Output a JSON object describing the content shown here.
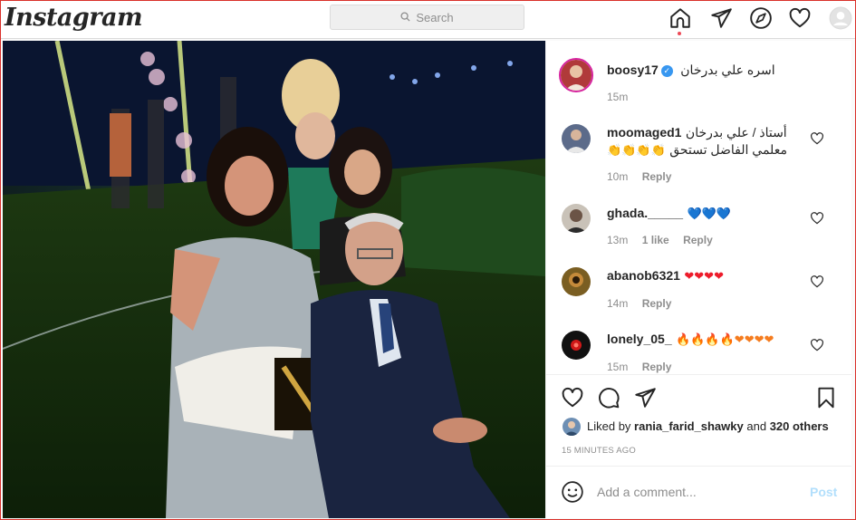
{
  "nav": {
    "logo": "Instagram",
    "search_placeholder": "Search",
    "icons": [
      "home-icon",
      "direct-icon",
      "explore-icon",
      "activity-heart-icon",
      "profile-avatar-icon"
    ]
  },
  "post": {
    "author": "boosy17",
    "caption": "اسره علي بدرخان",
    "time": "15m",
    "comments": [
      {
        "user": "moomaged1",
        "text_line1": "أستاذ / علي بدرخان",
        "text_line2": "معلمي الفاضل تستحق",
        "emoji": "👏👏👏👏",
        "time": "10m",
        "likes": "",
        "reply": "Reply"
      },
      {
        "user": "ghada._____",
        "text_line1": "💙💙💙",
        "text_line2": "",
        "emoji": "",
        "time": "13m",
        "likes": "1 like",
        "reply": "Reply"
      },
      {
        "user": "abanob6321",
        "text_line1": "❤❤❤❤",
        "text_line2": "",
        "emoji": "",
        "time": "14m",
        "likes": "",
        "reply": "Reply"
      },
      {
        "user": "lonely_05_",
        "text_line1": "🔥🔥🔥🔥❤❤❤❤",
        "text_line2": "",
        "emoji": "",
        "time": "15m",
        "likes": "",
        "reply": "Reply"
      }
    ],
    "liked_by_prefix": "Liked by",
    "liked_by_user": "rania_farid_shawky",
    "liked_by_and": "and",
    "liked_by_others": "320 others",
    "timestamp": "15 MINUTES AGO",
    "comment_placeholder": "Add a comment...",
    "post_button": "Post"
  },
  "colors": {
    "accent_blue": "#0095f6",
    "post_button_disabled": "#b2dffc",
    "notification_dot": "#ed4956",
    "verified": "#3897f0"
  }
}
